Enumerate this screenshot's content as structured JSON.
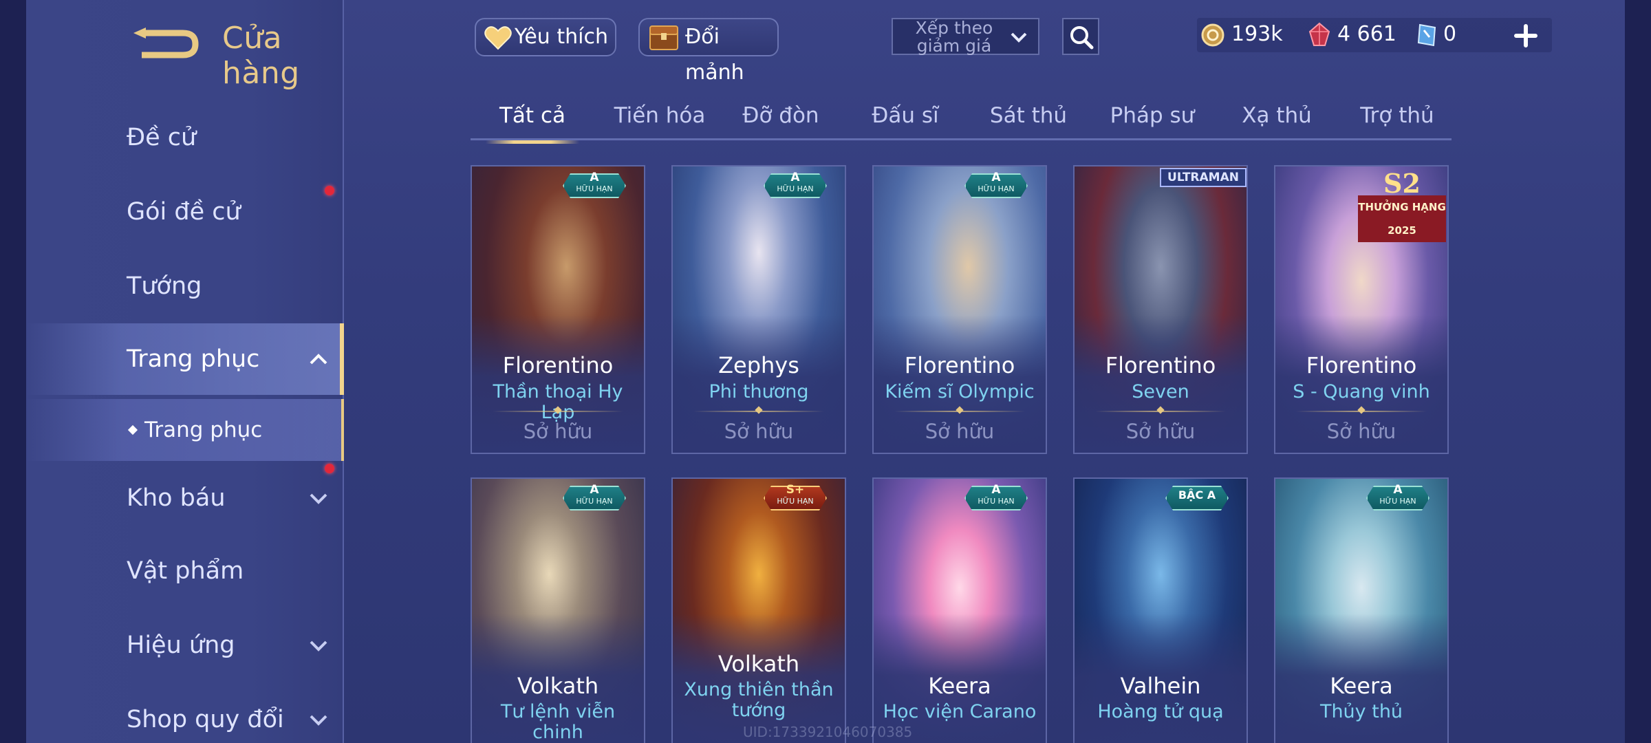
{
  "sidebar": {
    "title": "Cửa hàng",
    "items": [
      {
        "label": "Đề cử"
      },
      {
        "label": "Gói đề cử"
      },
      {
        "label": "Tướng"
      },
      {
        "label": "Trang phục"
      },
      {
        "label": "Kho báu"
      },
      {
        "label": "Vật phẩm"
      },
      {
        "label": "Hiệu ứng"
      },
      {
        "label": "Shop quy đổi"
      }
    ],
    "sub_item": "Trang phục"
  },
  "topbar": {
    "favorite": "Yêu thích",
    "exchange": "Đổi mảnh",
    "sort": "Xếp theo giảm giá",
    "currency": [
      {
        "value": "193k",
        "icon": "coin-icon"
      },
      {
        "value": "4 661",
        "icon": "ruby-icon"
      },
      {
        "value": "0",
        "icon": "voucher-icon"
      }
    ]
  },
  "tabs": [
    "Tất cả",
    "Tiến hóa",
    "Đỡ đòn",
    "Đấu sĩ",
    "Sát thủ",
    "Pháp sư",
    "Xạ thủ",
    "Trợ thủ"
  ],
  "cards": [
    {
      "hero": "Florentino",
      "skin": "Thần thoại Hy Lạp",
      "status": "Sở hữu",
      "badge_top": "A",
      "badge_sub": "HỮU HẠN"
    },
    {
      "hero": "Zephys",
      "skin": "Phi thương",
      "status": "Sở hữu",
      "badge_top": "A",
      "badge_sub": "HỮU HẠN"
    },
    {
      "hero": "Florentino",
      "skin": "Kiếm sĩ Olympic",
      "status": "Sở hữu",
      "badge_top": "A",
      "badge_sub": "HỮU HẠN"
    },
    {
      "hero": "Florentino",
      "skin": "Seven",
      "status": "Sở hữu",
      "badge_top": "ULTRAMAN",
      "badge_sub": ""
    },
    {
      "hero": "Florentino",
      "skin": "S - Quang vinh",
      "status": "Sở hữu",
      "badge_top": "S2",
      "badge_sub": "THƯỞNG HẠNG 2025"
    },
    {
      "hero": "Volkath",
      "skin": "Tư lệnh viễn chinh",
      "status": "",
      "badge_top": "A",
      "badge_sub": "HỮU HẠN"
    },
    {
      "hero": "Volkath",
      "skin": "Xung thiên thần tướng",
      "status": "",
      "badge_top": "S+",
      "badge_sub": "HỮU HẠN"
    },
    {
      "hero": "Keera",
      "skin": "Học viện Carano",
      "status": "",
      "badge_top": "A",
      "badge_sub": "HỮU HẠN"
    },
    {
      "hero": "Valhein",
      "skin": "Hoàng tử quạ",
      "status": "",
      "badge_top": "BẬC A",
      "badge_sub": ""
    },
    {
      "hero": "Keera",
      "skin": "Thủy thủ",
      "status": "",
      "badge_top": "A",
      "badge_sub": "HỮU HẠN"
    }
  ],
  "watermark": "UID:1733921046070385",
  "colors": {
    "accent_gold": "#f2d48d",
    "skin_name": "#7fd3f0",
    "notify_red": "#e3273a"
  }
}
